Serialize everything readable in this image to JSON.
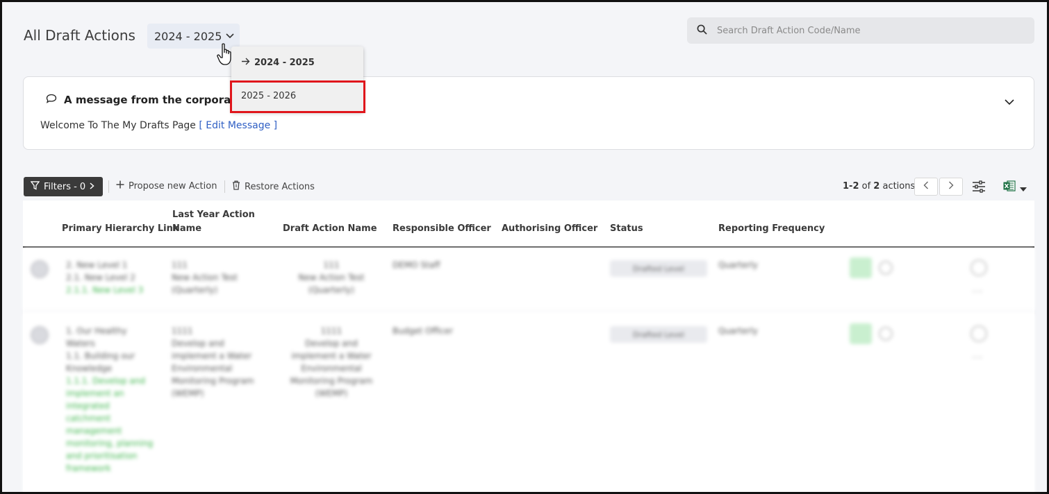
{
  "header": {
    "title": "All Draft Actions",
    "year_selected": "2024 - 2025",
    "search_placeholder": "Search Draft Action Code/Name"
  },
  "year_dropdown": {
    "selected_label": "2024 - 2025",
    "option_label": "2025 - 2026"
  },
  "message": {
    "title": "A message from the corporate t",
    "body": "Welcome To The My Drafts Page",
    "edit_link": "[ Edit Message ]"
  },
  "toolbar": {
    "filters_label": "Filters - 0",
    "propose_label": "Propose new Action",
    "restore_label": "Restore Actions",
    "count_range": "1-2",
    "count_of": " of ",
    "count_total": "2",
    "count_unit": " actions"
  },
  "table": {
    "columns": {
      "primary_hierarchy": "Primary Hierarchy Link",
      "last_year_name_1": "Last Year Action",
      "last_year_name_2": "Name",
      "draft_name": "Draft Action Name",
      "responsible": "Responsible Officer",
      "authorising": "Authorising Officer",
      "status": "Status",
      "frequency": "Reporting Frequency"
    },
    "rows": [
      {
        "hier_1": "2. New Level 1",
        "hier_2": "2.1. New Level 2",
        "hier_3": "2.1.1. New Level 3",
        "last_code": "111",
        "last_name_1": "New Action Test",
        "last_name_2": "(Quarterly)",
        "draft_code": "111",
        "draft_name_1": "New Action Test",
        "draft_name_2": "(Quarterly)",
        "responsible": "DEMO Staff",
        "status": "Drafted Level",
        "frequency": "Quarterly"
      },
      {
        "hier_1": "1. Our Healthy",
        "hier_1b": "Waters",
        "hier_2": "1.1. Building our",
        "hier_2b": "Knowledge",
        "hier_3": "1.1.1. Develop and",
        "hier_3b": "implement an",
        "hier_3c": "integrated",
        "hier_3d": "catchment",
        "hier_3e": "management",
        "hier_3f": "monitoring, planning",
        "hier_3g": "and prioritisation",
        "hier_3h": "framework",
        "last_code": "1111",
        "last_name_1": "Develop and",
        "last_name_2": "implement a Water",
        "last_name_3": "Environmental",
        "last_name_4": "Monitoring Program",
        "last_name_5": "(WEMP)",
        "draft_code": "1111",
        "draft_name_1": "Develop and",
        "draft_name_2": "implement a Water",
        "draft_name_3": "Environmental",
        "draft_name_4": "Monitoring Program",
        "draft_name_5": "(WEMP)",
        "responsible": "Budget Officer",
        "status": "Drafted Level",
        "frequency": "Quarterly"
      }
    ]
  },
  "colors": {
    "accent_link": "#2f5fc4",
    "highlight_box": "#e0161c",
    "green_text": "#3bb54a",
    "excel_green": "#1e7145"
  }
}
